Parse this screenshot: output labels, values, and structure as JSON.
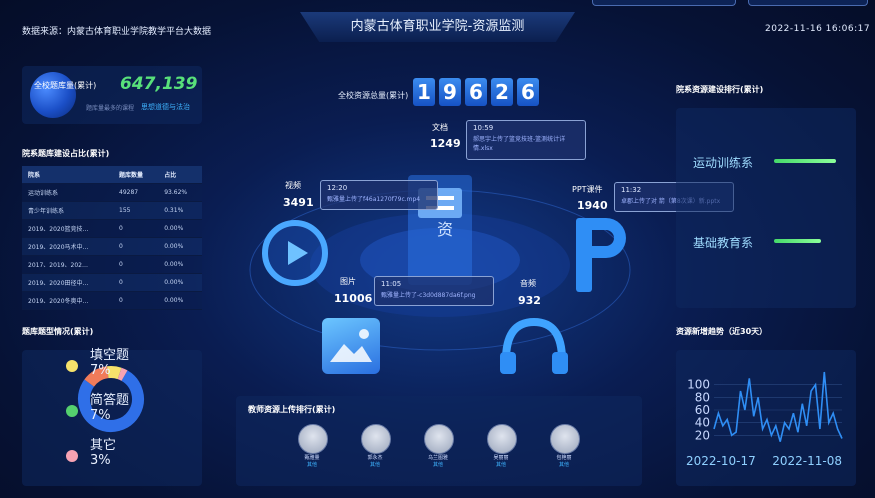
{
  "header": {
    "title": "内蒙古体育职业学院-资源监测",
    "data_source": "数据来源：内蒙古体育职业学院教学平台大数据",
    "datetime": "2022-11-16 16:06:17"
  },
  "kpi": {
    "label": "全校题库量(累计)",
    "value": "647,139",
    "sub_label": "题库量最多的课程",
    "sub_course": "思想道德与法治"
  },
  "dept_table": {
    "title": "院系题库建设占比(累计)",
    "headers": [
      "院系",
      "题库数量",
      "占比"
    ],
    "rows": [
      [
        "运动训练系",
        "49287",
        "93.62%"
      ],
      [
        "青少年训练系",
        "155",
        "0.31%"
      ],
      [
        "2019、2020篮竞技…",
        "0",
        "0.00%"
      ],
      [
        "2019、2020马术中…",
        "0",
        "0.00%"
      ],
      [
        "2017、2019、202…",
        "0",
        "0.00%"
      ],
      [
        "2019、2020田径中…",
        "0",
        "0.00%"
      ],
      [
        "2019、2020冬奥中…",
        "0",
        "0.00%"
      ]
    ]
  },
  "question_types": {
    "title": "题库题型情况(累计)",
    "items": [
      {
        "name": "填空题",
        "pct": "7%",
        "color": "#f6e26b"
      },
      {
        "name": "简答题",
        "pct": "7%",
        "color": "#54d06e"
      },
      {
        "name": "其它",
        "pct": "3%",
        "color": "#f7a3b3"
      }
    ],
    "ring_colors": [
      "#2f6fe8",
      "#f6e26b",
      "#f07b5a",
      "#f7a3b3"
    ]
  },
  "center": {
    "total_label": "全校资源总量(累计)",
    "digits": [
      "1",
      "9",
      "6",
      "2",
      "6"
    ],
    "categories": {
      "doc": {
        "label": "文档",
        "count": "1249"
      },
      "video": {
        "label": "视频",
        "count": "3491"
      },
      "ppt": {
        "label": "PPT课件",
        "count": "1940"
      },
      "image": {
        "label": "图片",
        "count": "11006"
      },
      "audio": {
        "label": "音频",
        "count": "932"
      }
    },
    "bubbles": {
      "doc": {
        "time": "10:59",
        "text": "郝思宇上传了篮竞技班-篮测统计详情.xlsx"
      },
      "video": {
        "time": "12:20",
        "text": "甄雅量上传了f46a1270f79c.mp4"
      },
      "ppt": {
        "time": "11:32",
        "text": "卓郡上传了对 箭（第8次课）新.pptx"
      },
      "image": {
        "time": "11:05",
        "text": "甄雅量上传了-c3d0d887da6f.png"
      }
    },
    "center_glyph": "资"
  },
  "teacher_rank": {
    "title": "教师资源上传排行(累计)",
    "teachers": [
      {
        "name": "甄雅量",
        "dept": "其他"
      },
      {
        "name": "郭永杰",
        "dept": "其他"
      },
      {
        "name": "乌兰图雅",
        "dept": "其他"
      },
      {
        "name": "吴丽丽",
        "dept": "其他"
      },
      {
        "name": "包艳丽",
        "dept": "其他"
      }
    ]
  },
  "dept_resource_rank": {
    "title": "院系资源建设排行(累计)",
    "items": [
      {
        "name": "运动训练系",
        "level": 1.0
      },
      {
        "name": "基础教育系",
        "level": 0.75
      }
    ]
  },
  "trend": {
    "title": "资源新增趋势（近30天）",
    "x_labels": [
      "2022-10-17",
      "2022-11-08"
    ],
    "y_ticks": [
      "100",
      "80",
      "60",
      "40",
      "20"
    ]
  },
  "chart_data": {
    "type": "line",
    "title": "资源新增趋势（近30天）",
    "ylim": [
      0,
      120
    ],
    "y_ticks": [
      20,
      40,
      60,
      80,
      100
    ],
    "x_tick_labels": [
      "2022-10-17",
      "2022-11-08"
    ],
    "values": [
      30,
      55,
      35,
      45,
      20,
      25,
      90,
      60,
      110,
      50,
      80,
      30,
      45,
      20,
      35,
      10,
      40,
      30,
      55,
      25,
      70,
      35,
      90,
      100,
      30,
      120,
      40,
      55,
      30,
      15
    ],
    "color": "#2f8ef5"
  },
  "colors": {
    "accent": "#3fb4ff",
    "kpi": "#58e07a",
    "bar": "#46d96a"
  }
}
